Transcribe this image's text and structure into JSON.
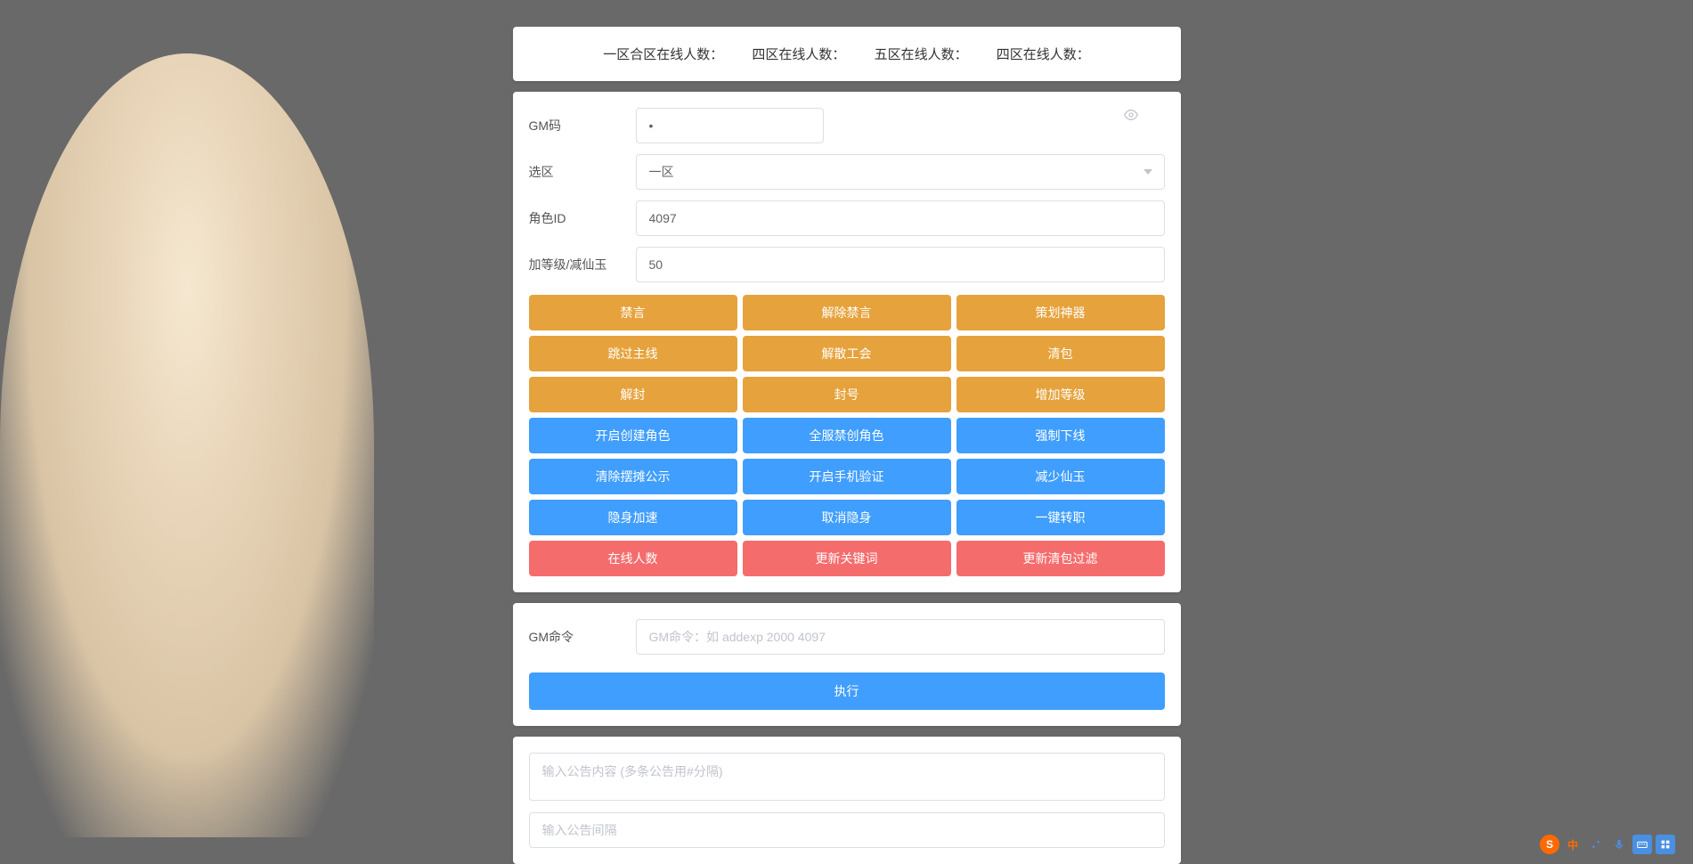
{
  "header": {
    "s1": "一区合区在线人数：",
    "s2": "四区在线人数：",
    "s3": "五区在线人数：",
    "s4": "四区在线人数："
  },
  "form": {
    "gmcode_label": "GM码",
    "gmcode_value": "•",
    "zone_label": "选区",
    "zone_value": "一区",
    "roleid_label": "角色ID",
    "roleid_value": "4097",
    "level_label": "加等级/减仙玉",
    "level_value": "50"
  },
  "buttons": {
    "orange": [
      [
        "禁言",
        "解除禁言",
        "策划神器"
      ],
      [
        "跳过主线",
        "解散工会",
        "清包"
      ],
      [
        "解封",
        "封号",
        "增加等级"
      ]
    ],
    "blue": [
      [
        "开启创建角色",
        "全服禁创角色",
        "强制下线"
      ],
      [
        "清除摆摊公示",
        "开启手机验证",
        "减少仙玉"
      ],
      [
        "隐身加速",
        "取消隐身",
        "一键转职"
      ]
    ],
    "red": [
      [
        "在线人数",
        "更新关键词",
        "更新清包过滤"
      ]
    ]
  },
  "cmd": {
    "label": "GM命令",
    "placeholder": "GM命令：如 addexp 2000 4097",
    "execute": "执行"
  },
  "announce": {
    "content_placeholder": "输入公告内容 (多条公告用#分隔)",
    "interval_placeholder": "输入公告间隔"
  },
  "ime": {
    "s": "S",
    "cn": "中"
  }
}
